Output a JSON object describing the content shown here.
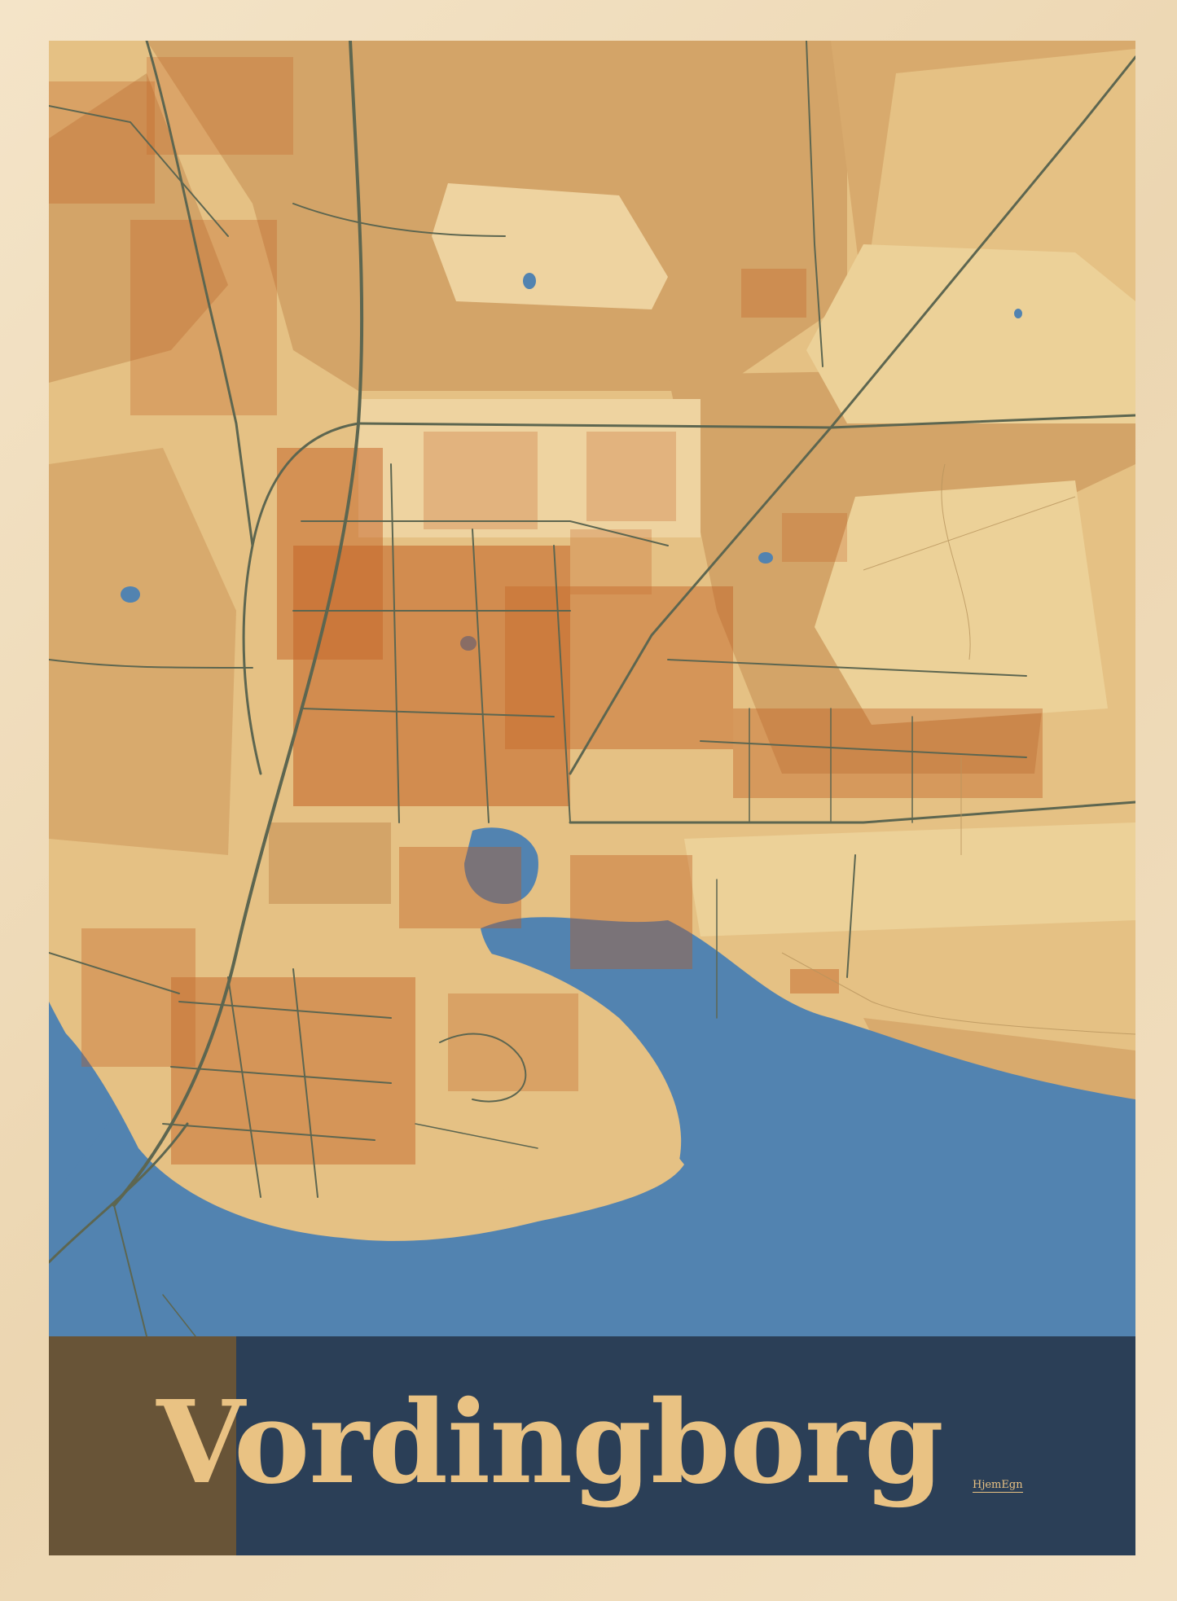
{
  "poster": {
    "city_name": "Vordingborg",
    "brand": "HjemEgn"
  },
  "colors": {
    "frame": "#f1dfc0",
    "land": "#e5c184",
    "fields": "#d3a468",
    "buildings": "#bf5a1d",
    "roads": "#5d6650",
    "water": "#5283b0",
    "title_band": "#2b3f57",
    "title_text": "#e9c283"
  }
}
